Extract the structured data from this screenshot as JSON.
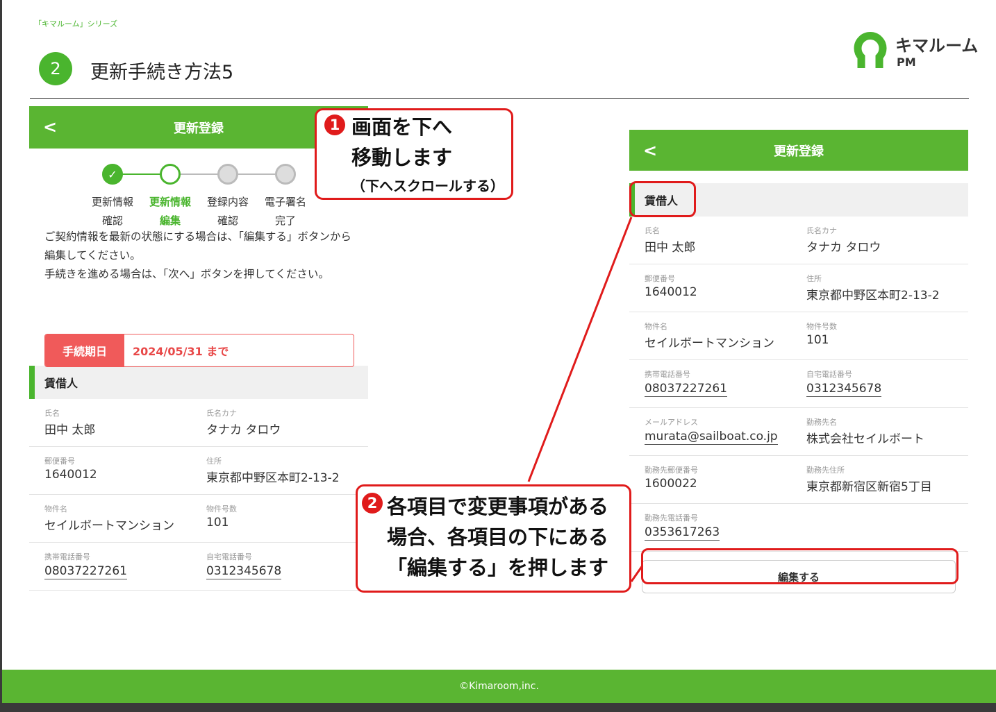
{
  "header": {
    "series": "「キマルーム」シリーズ",
    "step_number": "2",
    "title": "更新手続き方法5",
    "logo_text": "キマルーム",
    "logo_sub": "PM"
  },
  "left_screen": {
    "title": "更新登録",
    "back": "<",
    "steps": [
      {
        "label": "更新情報\n確認",
        "state": "done"
      },
      {
        "label": "更新情報\n編集",
        "state": "current"
      },
      {
        "label": "登録内容\n確認",
        "state": "todo"
      },
      {
        "label": "電子署名\n完了",
        "state": "todo"
      }
    ],
    "check": "✓",
    "intro_line1": "ご契約情報を最新の状態にする場合は、「編集する」ボタンから編集してください。",
    "intro_line2": "手続きを進める場合は、「次へ」ボタンを押してください。",
    "deadline_label": "手続期日",
    "deadline_value": "2024/05/31 まで",
    "section": "賃借人",
    "rows": [
      [
        {
          "k": "氏名",
          "v": "田中 太郎"
        },
        {
          "k": "氏名カナ",
          "v": "タナカ タロウ"
        }
      ],
      [
        {
          "k": "郵便番号",
          "v": "1640012"
        },
        {
          "k": "住所",
          "v": "東京都中野区本町2-13-2"
        }
      ],
      [
        {
          "k": "物件名",
          "v": "セイルボートマンション"
        },
        {
          "k": "物件号数",
          "v": "101"
        }
      ],
      [
        {
          "k": "携帯電話番号",
          "v": "08037227261"
        },
        {
          "k": "自宅電話番号",
          "v": "0312345678"
        }
      ]
    ]
  },
  "right_screen": {
    "title": "更新登録",
    "back": "<",
    "section": "賃借人",
    "rows": [
      [
        {
          "k": "氏名",
          "v": "田中 太郎"
        },
        {
          "k": "氏名カナ",
          "v": "タナカ タロウ"
        }
      ],
      [
        {
          "k": "郵便番号",
          "v": "1640012"
        },
        {
          "k": "住所",
          "v": "東京都中野区本町2-13-2"
        }
      ],
      [
        {
          "k": "物件名",
          "v": "セイルボートマンション"
        },
        {
          "k": "物件号数",
          "v": "101"
        }
      ],
      [
        {
          "k": "携帯電話番号",
          "v": "08037227261"
        },
        {
          "k": "自宅電話番号",
          "v": "0312345678"
        }
      ],
      [
        {
          "k": "メールアドレス",
          "v": "murata@sailboat.co.jp"
        },
        {
          "k": "勤務先名",
          "v": "株式会社セイルボート"
        }
      ],
      [
        {
          "k": "勤務先郵便番号",
          "v": "1600022"
        },
        {
          "k": "勤務先住所",
          "v": "東京都新宿区新宿5丁目"
        }
      ],
      [
        {
          "k": "勤務先電話番号",
          "v": "0353617263"
        }
      ]
    ],
    "edit_button": "編集する"
  },
  "callouts": {
    "one_num": "1",
    "one_line1": "画面を下へ",
    "one_line2": "移動します",
    "one_sub": "（下へスクロールする）",
    "two_num": "2",
    "two_line1": "各項目で変更事項がある",
    "two_line2": "場合、各項目の下にある",
    "two_line3": "「編集する」を押します"
  },
  "footer": "©Kimaroom,inc.",
  "colors": {
    "brand_green": "#5ab532",
    "accent_red": "#e01b1b",
    "deadline_red": "#f05a5a"
  }
}
